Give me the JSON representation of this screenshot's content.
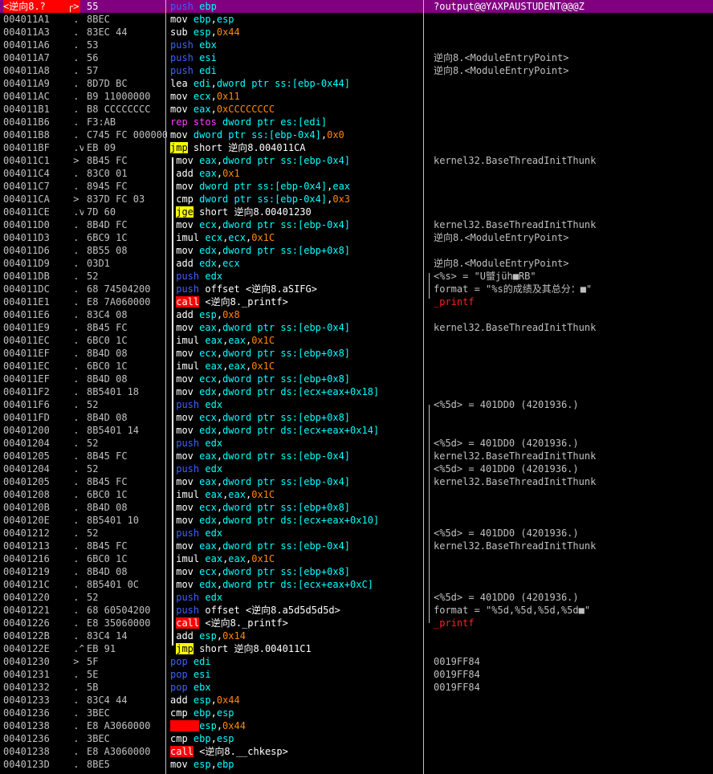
{
  "rows": [
    {
      "addr": "<逆向8.?",
      "mark": "┌> ",
      "hex": "55",
      "asm": "push ebp",
      "cmt": "?output@@YAXPAUSTUDENT@@@Z",
      "mnem": "push",
      "style": "hl"
    },
    {
      "addr": "004011A1",
      "mark": " . ",
      "hex": "8BEC",
      "asm": "mov ebp,esp",
      "cmt": ""
    },
    {
      "addr": "004011A3",
      "mark": " . ",
      "hex": "83EC 44",
      "asm": "sub esp,0x44",
      "cmt": ""
    },
    {
      "addr": "004011A6",
      "mark": " . ",
      "hex": "53",
      "asm": "push ebx",
      "cmt": ""
    },
    {
      "addr": "004011A7",
      "mark": " . ",
      "hex": "56",
      "asm": "push esi",
      "cmt": "逆向8.<ModuleEntryPoint>"
    },
    {
      "addr": "004011A8",
      "mark": " . ",
      "hex": "57",
      "asm": "push edi",
      "cmt": "逆向8.<ModuleEntryPoint>"
    },
    {
      "addr": "004011A9",
      "mark": " . ",
      "hex": "8D7D BC",
      "asm": "lea edi,dword ptr ss:[ebp-0x44]",
      "cmt": ""
    },
    {
      "addr": "004011AC",
      "mark": " . ",
      "hex": "B9 11000000",
      "asm": "mov ecx,0x11",
      "cmt": ""
    },
    {
      "addr": "004011B1",
      "mark": " . ",
      "hex": "B8 CCCCCCCC",
      "asm": "mov eax,0xCCCCCCCC",
      "cmt": ""
    },
    {
      "addr": "004011B6",
      "mark": " . ",
      "hex": "F3:AB",
      "asm": "rep stos dword ptr es:[edi]",
      "cmt": ""
    },
    {
      "addr": "004011B8",
      "mark": " . ",
      "hex": "C745 FC 00000000",
      "asm": "mov dword ptr ss:[ebp-0x4],0x0",
      "cmt": ""
    },
    {
      "addr": "004011BF",
      "mark": " .v ",
      "hex": "EB 09",
      "asm": "jmp short 逆向8.004011CA",
      "cmt": ""
    },
    {
      "addr": "004011C1",
      "mark": " > ",
      "hex": "8B45 FC",
      "asm": "mov eax,dword ptr ss:[ebp-0x4]",
      "cmt": "kernel32.BaseThreadInitThunk"
    },
    {
      "addr": "004011C4",
      "mark": " . ",
      "hex": "83C0 01",
      "asm": "add eax,0x1",
      "cmt": ""
    },
    {
      "addr": "004011C7",
      "mark": " . ",
      "hex": "8945 FC",
      "asm": "mov dword ptr ss:[ebp-0x4],eax",
      "cmt": ""
    },
    {
      "addr": "004011CA",
      "mark": " > ",
      "hex": "837D FC 03",
      "asm": "cmp dword ptr ss:[ebp-0x4],0x3",
      "cmt": ""
    },
    {
      "addr": "004011CE",
      "mark": " .v ",
      "hex": "7D 60",
      "asm": "jge short 逆向8.00401230",
      "cmt": ""
    },
    {
      "addr": "004011D0",
      "mark": " . ",
      "hex": "8B4D FC",
      "asm": "mov ecx,dword ptr ss:[ebp-0x4]",
      "cmt": "kernel32.BaseThreadInitThunk"
    },
    {
      "addr": "004011D3",
      "mark": " . ",
      "hex": "6BC9 1C",
      "asm": "imul ecx,ecx,0x1C",
      "cmt": "逆向8.<ModuleEntryPoint>"
    },
    {
      "addr": "004011D6",
      "mark": " . ",
      "hex": "8B55 08",
      "asm": "mov edx,dword ptr ss:[ebp+0x8]",
      "cmt": ""
    },
    {
      "addr": "004011D9",
      "mark": " . ",
      "hex": "03D1",
      "asm": "add edx,ecx",
      "cmt": "逆向8.<ModuleEntryPoint>"
    },
    {
      "addr": "004011DB",
      "mark": " . ",
      "hex": "52",
      "asm": "push edx",
      "cmt": "<%s> = \"U蠈jüh■RB\""
    },
    {
      "addr": "004011DC",
      "mark": " . ",
      "hex": "68 74504200",
      "asm": "push offset <逆向8.aSIFG>",
      "cmt": "format = \"%s的成绩及其总分：■\""
    },
    {
      "addr": "004011E1",
      "mark": " . ",
      "hex": "E8 7A060000",
      "asm": "call <逆向8._printf>",
      "cmt": "_printf"
    },
    {
      "addr": "004011E6",
      "mark": " . ",
      "hex": "83C4 08",
      "asm": "add esp,0x8",
      "cmt": ""
    },
    {
      "addr": "004011E9",
      "mark": " . ",
      "hex": "8B45 FC",
      "asm": "mov eax,dword ptr ss:[ebp-0x4]",
      "cmt": "kernel32.BaseThreadInitThunk"
    },
    {
      "addr": "004011EC",
      "mark": " . ",
      "hex": "6BC0 1C",
      "asm": "imul eax,eax,0x1C",
      "cmt": ""
    },
    {
      "addr": "004011EF",
      "mark": " . ",
      "hex": "8B4D 08",
      "asm": "mov ecx,dword ptr ss:[ebp+0x8]",
      "cmt": ""
    },
    {
      "addr": "004011EC",
      "mark": " . ",
      "hex": "6BC0 1C",
      "asm": "imul eax,eax,0x1C",
      "cmt": ""
    },
    {
      "addr": "004011EF",
      "mark": " . ",
      "hex": "8B4D 08",
      "asm": "mov ecx,dword ptr ss:[ebp+0x8]",
      "cmt": ""
    },
    {
      "addr": "004011F2",
      "mark": " . ",
      "hex": "8B5401 18",
      "asm": "mov edx,dword ptr ds:[ecx+eax+0x18]",
      "cmt": ""
    },
    {
      "addr": "004011F6",
      "mark": " . ",
      "hex": "52",
      "asm": "push edx",
      "cmt": "<%5d> = 401DD0 (4201936.)"
    },
    {
      "addr": "004011FD",
      "mark": " . ",
      "hex": "8B4D 08",
      "asm": "mov ecx,dword ptr ss:[ebp+0x8]",
      "cmt": ""
    },
    {
      "addr": "00401200",
      "mark": " . ",
      "hex": "8B5401 14",
      "asm": "mov edx,dword ptr ds:[ecx+eax+0x14]",
      "cmt": ""
    },
    {
      "addr": "00401204",
      "mark": " . ",
      "hex": "52",
      "asm": "push edx",
      "cmt": "<%5d> = 401DD0 (4201936.)"
    },
    {
      "addr": "00401205",
      "mark": " . ",
      "hex": "8B45 FC",
      "asm": "mov eax,dword ptr ss:[ebp-0x4]",
      "cmt": "kernel32.BaseThreadInitThunk"
    },
    {
      "addr": "00401204",
      "mark": " . ",
      "hex": "52",
      "asm": "push edx",
      "cmt": "<%5d> = 401DD0 (4201936.)"
    },
    {
      "addr": "00401205",
      "mark": " . ",
      "hex": "8B45 FC",
      "asm": "mov eax,dword ptr ss:[ebp-0x4]",
      "cmt": "kernel32.BaseThreadInitThunk"
    },
    {
      "addr": "00401208",
      "mark": " . ",
      "hex": "6BC0 1C",
      "asm": "imul eax,eax,0x1C",
      "cmt": ""
    },
    {
      "addr": "0040120B",
      "mark": " . ",
      "hex": "8B4D 08",
      "asm": "mov ecx,dword ptr ss:[ebp+0x8]",
      "cmt": ""
    },
    {
      "addr": "0040120E",
      "mark": " . ",
      "hex": "8B5401 10",
      "asm": "mov edx,dword ptr ds:[ecx+eax+0x10]",
      "cmt": ""
    },
    {
      "addr": "00401212",
      "mark": " . ",
      "hex": "52",
      "asm": "push edx",
      "cmt": "<%5d> = 401DD0 (4201936.)"
    },
    {
      "addr": "00401213",
      "mark": " . ",
      "hex": "8B45 FC",
      "asm": "mov eax,dword ptr ss:[ebp-0x4]",
      "cmt": "kernel32.BaseThreadInitThunk"
    },
    {
      "addr": "00401216",
      "mark": " . ",
      "hex": "6BC0 1C",
      "asm": "imul eax,eax,0x1C",
      "cmt": ""
    },
    {
      "addr": "00401219",
      "mark": " . ",
      "hex": "8B4D 08",
      "asm": "mov ecx,dword ptr ss:[ebp+0x8]",
      "cmt": ""
    },
    {
      "addr": "0040121C",
      "mark": " . ",
      "hex": "8B5401 0C",
      "asm": "mov edx,dword ptr ds:[ecx+eax+0xC]",
      "cmt": ""
    },
    {
      "addr": "00401220",
      "mark": " . ",
      "hex": "52",
      "asm": "push edx",
      "cmt": "<%5d> = 401DD0 (4201936.)"
    },
    {
      "addr": "00401221",
      "mark": " . ",
      "hex": "68 60504200",
      "asm": "push offset <逆向8.a5d5d5d5d>",
      "cmt": "format = \"%5d,%5d,%5d,%5d■\""
    },
    {
      "addr": "00401226",
      "mark": " . ",
      "hex": "E8 35060000",
      "asm": "call <逆向8._printf>",
      "cmt": "_printf"
    },
    {
      "addr": "0040122B",
      "mark": " . ",
      "hex": "83C4 14",
      "asm": "add esp,0x14",
      "cmt": ""
    },
    {
      "addr": "0040122E",
      "mark": " .^ ",
      "hex": "EB 91",
      "asm": "jmp short 逆向8.004011C1",
      "cmt": ""
    },
    {
      "addr": "00401230",
      "mark": " > ",
      "hex": "5F",
      "asm": "pop edi",
      "cmt": "0019FF84"
    },
    {
      "addr": "00401231",
      "mark": " . ",
      "hex": "5E",
      "asm": "pop esi",
      "cmt": "0019FF84"
    },
    {
      "addr": "00401232",
      "mark": " . ",
      "hex": "5B",
      "asm": "pop ebx",
      "cmt": "0019FF84"
    },
    {
      "addr": "00401233",
      "mark": " . ",
      "hex": "83C4 44",
      "asm": "add esp,0x44",
      "cmt": ""
    },
    {
      "addr": "00401236",
      "mark": " . ",
      "hex": "3BEC",
      "asm": "cmp ebp,esp",
      "cmt": ""
    },
    {
      "addr": "00401238",
      "mark": " . ",
      "hex": "E8 A3060000",
      "asm": "esp,0x44",
      "cmt": ""
    },
    {
      "addr": "00401236",
      "mark": " . ",
      "hex": "3BEC",
      "asm": "cmp ebp,esp",
      "cmt": ""
    },
    {
      "addr": "00401238",
      "mark": " . ",
      "hex": "E8 A3060000",
      "asm": "call <逆向8.__chkesp>",
      "cmt": ""
    },
    {
      "addr": "0040123D",
      "mark": " . ",
      "hex": "8BE5",
      "asm": "mov esp,ebp",
      "cmt": ""
    }
  ],
  "colors": {
    "background": "#000000",
    "selected_row": "#800080",
    "call_highlight": "#ff0000",
    "jump_highlight": "#ffff00",
    "push_pop": "#4060ff",
    "register": "#00ffff",
    "immediate": "#ff8800",
    "memory": "#ff40ff"
  }
}
